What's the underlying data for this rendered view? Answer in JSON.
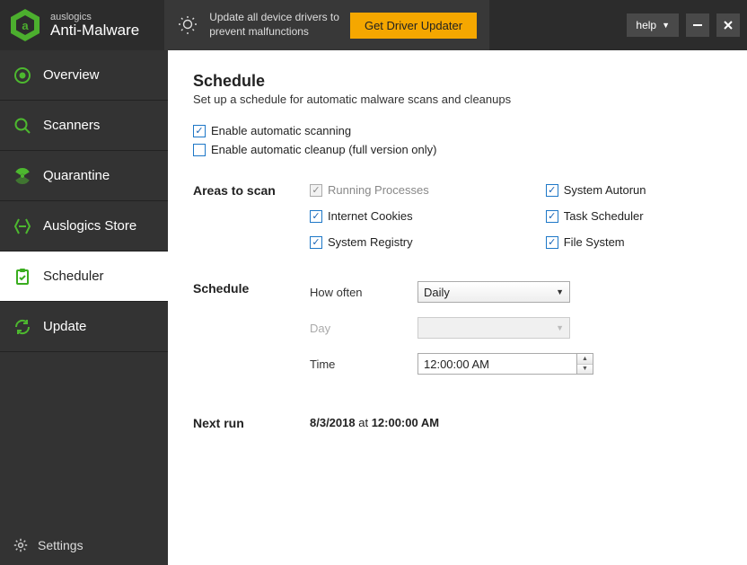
{
  "titlebar": {
    "brand": "auslogics",
    "name": "Anti-Malware",
    "promo_line1": "Update all device drivers to",
    "promo_line2": "prevent malfunctions",
    "promo_button": "Get Driver Updater",
    "help": "help"
  },
  "sidebar": {
    "overview": "Overview",
    "scanners": "Scanners",
    "quarantine": "Quarantine",
    "store": "Auslogics Store",
    "scheduler": "Scheduler",
    "update": "Update",
    "settings": "Settings"
  },
  "page": {
    "title": "Schedule",
    "subtitle": "Set up a schedule for automatic malware scans and cleanups",
    "enable_scan": "Enable automatic scanning",
    "enable_cleanup": "Enable automatic cleanup (full version only)",
    "areas_label": "Areas to scan",
    "areas": {
      "running": "Running Processes",
      "cookies": "Internet Cookies",
      "registry": "System Registry",
      "autorun": "System Autorun",
      "tasksched": "Task Scheduler",
      "filesystem": "File System"
    },
    "schedule_label": "Schedule",
    "how_often_label": "How often",
    "how_often_value": "Daily",
    "day_label": "Day",
    "day_value": "",
    "time_label": "Time",
    "time_value": "12:00:00 AM",
    "nextrun_label": "Next run",
    "nextrun_date": "8/3/2018",
    "nextrun_at": " at ",
    "nextrun_time": "12:00:00 AM"
  }
}
